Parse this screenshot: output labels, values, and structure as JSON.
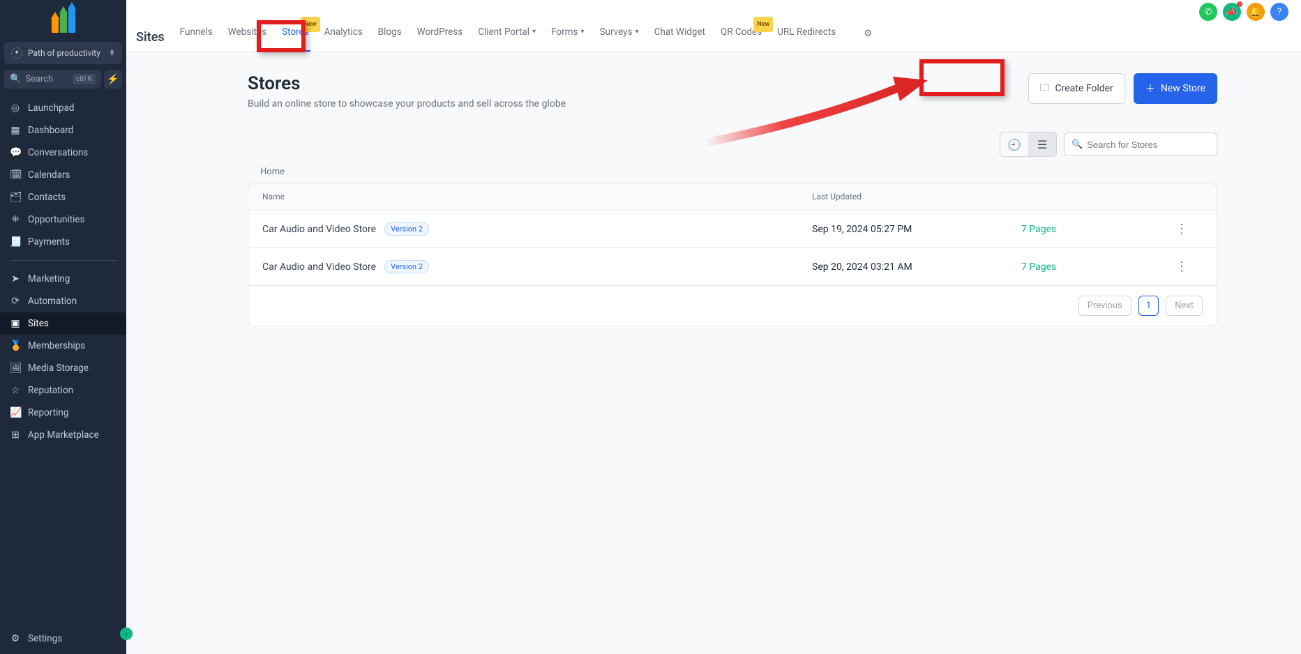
{
  "account": {
    "name": "Path of productivity"
  },
  "search": {
    "placeholder": "Search",
    "kbd": "ctrl K"
  },
  "sidebar": {
    "items": [
      {
        "label": "Launchpad"
      },
      {
        "label": "Dashboard"
      },
      {
        "label": "Conversations"
      },
      {
        "label": "Calendars"
      },
      {
        "label": "Contacts"
      },
      {
        "label": "Opportunities"
      },
      {
        "label": "Payments"
      },
      {
        "label": "Marketing"
      },
      {
        "label": "Automation"
      },
      {
        "label": "Sites"
      },
      {
        "label": "Memberships"
      },
      {
        "label": "Media Storage"
      },
      {
        "label": "Reputation"
      },
      {
        "label": "Reporting"
      },
      {
        "label": "App Marketplace"
      }
    ],
    "settings": "Settings"
  },
  "brand": "Sites",
  "tabs": [
    {
      "label": "Funnels"
    },
    {
      "label": "Websites"
    },
    {
      "label": "Stores",
      "badge": "New",
      "active": true
    },
    {
      "label": "Analytics"
    },
    {
      "label": "Blogs"
    },
    {
      "label": "WordPress"
    },
    {
      "label": "Client Portal",
      "chev": true
    },
    {
      "label": "Forms",
      "chev": true
    },
    {
      "label": "Surveys",
      "chev": true
    },
    {
      "label": "Chat Widget"
    },
    {
      "label": "QR Codes",
      "badge": "New"
    },
    {
      "label": "URL Redirects"
    }
  ],
  "page": {
    "title": "Stores",
    "subtitle": "Build an online store to showcase your products and sell across the globe",
    "createFolder": "Create Folder",
    "newStore": "New Store",
    "searchPlaceholder": "Search for Stores",
    "breadcrumb": "Home",
    "columns": {
      "name": "Name",
      "updated": "Last Updated"
    },
    "rows": [
      {
        "name": "Car Audio and Video Store",
        "version": "Version 2",
        "updated": "Sep 19, 2024 05:27 PM",
        "pages": "7 Pages"
      },
      {
        "name": "Car Audio and Video Store",
        "version": "Version 2",
        "updated": "Sep 20, 2024 03:21 AM",
        "pages": "7 Pages"
      }
    ],
    "pager": {
      "prev": "Previous",
      "page": "1",
      "next": "Next"
    }
  }
}
